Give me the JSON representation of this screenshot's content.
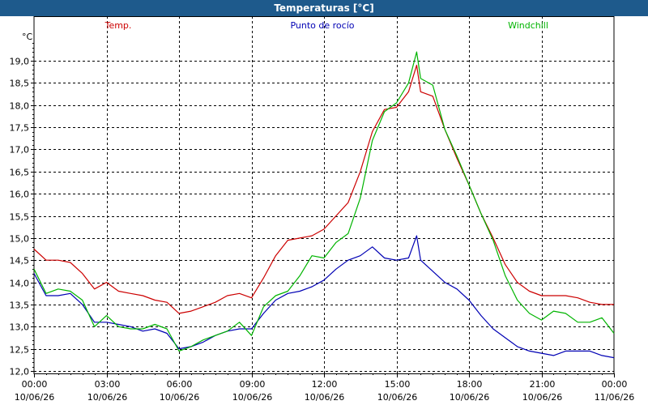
{
  "window": {
    "title": "Temperaturas [°C]"
  },
  "chart_data": {
    "type": "line",
    "title": "Temperaturas [°C]",
    "unit_label": "°C",
    "ylim": [
      12.0,
      19.5
    ],
    "xlim_hours": [
      0,
      24
    ],
    "grid": true,
    "legend_placement": "top",
    "y_ticks": [
      "12,0",
      "12,5",
      "13,0",
      "13,5",
      "14,0",
      "14,5",
      "15,0",
      "15,5",
      "16,0",
      "16,5",
      "17,0",
      "17,5",
      "18,0",
      "18,5",
      "19,0"
    ],
    "x_ticks": [
      {
        "time": "00:00",
        "date": "10/06/26"
      },
      {
        "time": "03:00",
        "date": "10/06/26"
      },
      {
        "time": "06:00",
        "date": "10/06/26"
      },
      {
        "time": "09:00",
        "date": "10/06/26"
      },
      {
        "time": "12:00",
        "date": "10/06/26"
      },
      {
        "time": "15:00",
        "date": "10/06/26"
      },
      {
        "time": "18:00",
        "date": "10/06/26"
      },
      {
        "time": "21:00",
        "date": "10/06/26"
      },
      {
        "time": "00:00",
        "date": "11/06/26"
      }
    ],
    "x": [
      "00:00",
      "00:30",
      "01:00",
      "01:30",
      "02:00",
      "02:30",
      "03:00",
      "03:30",
      "04:00",
      "04:30",
      "05:00",
      "05:30",
      "06:00",
      "06:30",
      "07:00",
      "07:30",
      "08:00",
      "08:30",
      "09:00",
      "09:30",
      "10:00",
      "10:30",
      "11:00",
      "11:30",
      "12:00",
      "12:30",
      "13:00",
      "13:30",
      "14:00",
      "14:30",
      "15:00",
      "15:30",
      "15:50",
      "16:00",
      "16:30",
      "17:00",
      "17:30",
      "18:00",
      "18:30",
      "19:00",
      "19:30",
      "20:00",
      "20:30",
      "21:00",
      "21:30",
      "22:00",
      "22:30",
      "23:00",
      "23:30",
      "24:00"
    ],
    "series": [
      {
        "name": "Temp.",
        "color": "#cc0000",
        "values": [
          14.75,
          14.5,
          14.5,
          14.45,
          14.2,
          13.85,
          14.0,
          13.8,
          13.75,
          13.7,
          13.6,
          13.55,
          13.3,
          13.35,
          13.45,
          13.55,
          13.7,
          13.75,
          13.65,
          14.1,
          14.6,
          14.95,
          15.0,
          15.05,
          15.2,
          15.5,
          15.8,
          16.5,
          17.4,
          17.9,
          17.95,
          18.3,
          18.9,
          18.3,
          18.2,
          17.45,
          16.8,
          16.2,
          15.55,
          15.0,
          14.4,
          14.0,
          13.8,
          13.7,
          13.7,
          13.7,
          13.65,
          13.55,
          13.5,
          13.5
        ]
      },
      {
        "name": "Punto de rocío",
        "color": "#0000b4",
        "values": [
          14.2,
          13.7,
          13.7,
          13.75,
          13.5,
          13.1,
          13.1,
          13.05,
          13.0,
          12.9,
          12.95,
          12.85,
          12.5,
          12.55,
          12.65,
          12.8,
          12.9,
          12.95,
          12.95,
          13.3,
          13.6,
          13.75,
          13.8,
          13.9,
          14.05,
          14.3,
          14.5,
          14.6,
          14.8,
          14.55,
          14.5,
          14.55,
          15.05,
          14.5,
          14.25,
          14.0,
          13.85,
          13.6,
          13.25,
          12.95,
          12.75,
          12.55,
          12.45,
          12.4,
          12.35,
          12.45,
          12.45,
          12.45,
          12.35,
          12.3
        ]
      },
      {
        "name": "Windchill",
        "color": "#00b400",
        "values": [
          14.3,
          13.75,
          13.85,
          13.8,
          13.6,
          13.0,
          13.25,
          13.0,
          12.95,
          12.95,
          13.05,
          12.95,
          12.45,
          12.55,
          12.7,
          12.8,
          12.9,
          13.1,
          12.8,
          13.45,
          13.7,
          13.8,
          14.15,
          14.6,
          14.55,
          14.9,
          15.1,
          15.9,
          17.2,
          17.85,
          18.05,
          18.5,
          19.2,
          18.6,
          18.45,
          17.45,
          16.85,
          16.2,
          15.55,
          14.95,
          14.15,
          13.6,
          13.3,
          13.15,
          13.35,
          13.3,
          13.1,
          13.1,
          13.2,
          12.85
        ]
      }
    ]
  }
}
